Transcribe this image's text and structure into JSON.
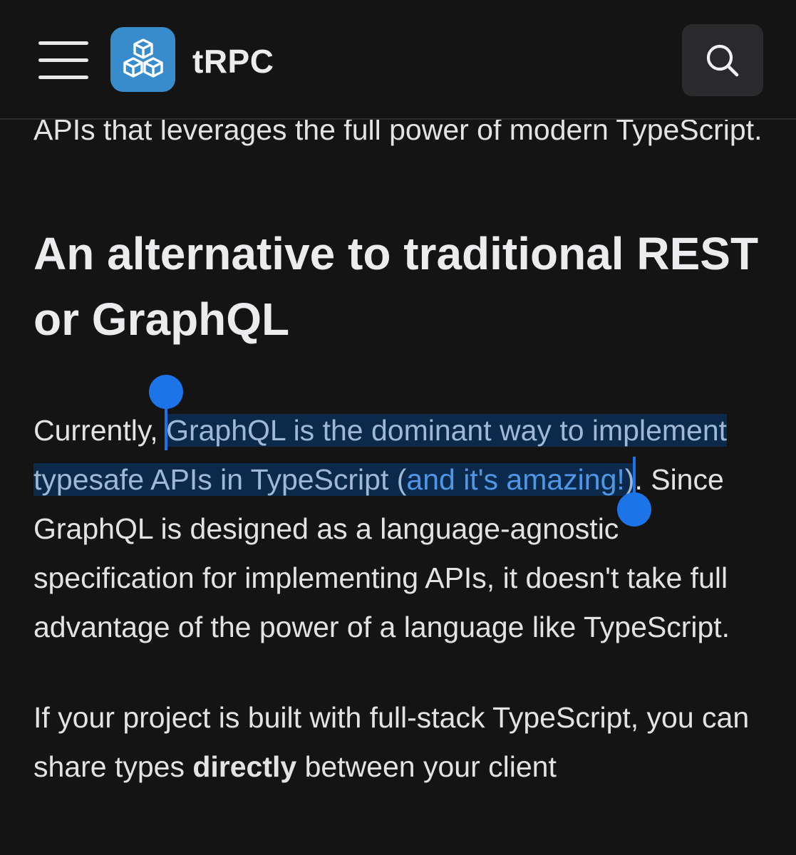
{
  "header": {
    "brand": "tRPC",
    "icons": {
      "menu": "hamburger-menu-icon",
      "logo": "cubes-logo-icon",
      "search": "search-icon"
    },
    "colors": {
      "background": "#141415",
      "logo_bg": "#398ccb",
      "search_bg": "#2a2a2d"
    }
  },
  "article": {
    "intro": "APIs that leverages the full power of modern TypeScript.",
    "heading": "An alternative to traditional REST or GraphQL",
    "para1": {
      "lead": "Currently, ",
      "selected": "GraphQL is the dominant way to implement typesafe APIs in TypeScript (",
      "link": "and it's amazing!",
      "selected_end": ")",
      "rest": ". Since GraphQL is designed as a language-agnostic specification for implementing APIs, it doesn't take full advantage of the power of a language like TypeScript."
    },
    "para2": {
      "start": "If your project is built with full-stack TypeScript, you can share types ",
      "bold": "directly",
      "end": " between your client"
    },
    "colors": {
      "text": "#e3e3e5",
      "selection_bg": "#0b2a4b",
      "link": "#4f97e6",
      "selection_handle": "#1d74e8"
    }
  }
}
